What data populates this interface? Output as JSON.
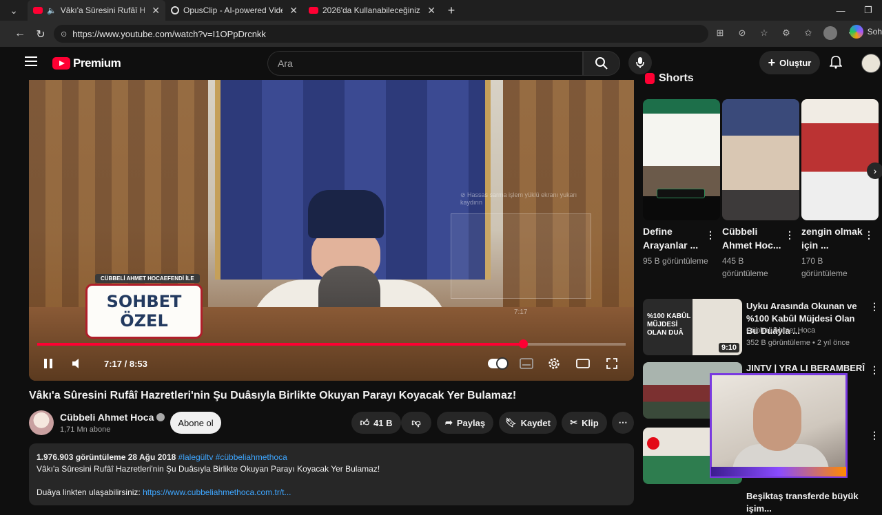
{
  "browser": {
    "tabs": [
      {
        "title": "Vâkı'a Sûresini Rufâî Hazretleri",
        "active": true
      },
      {
        "title": "OpusClip - AI-powered Video Rep",
        "active": false
      },
      {
        "title": "2026'da Kullanabileceğiniz En İyi 0",
        "active": false
      }
    ],
    "url": "https://www.youtube.com/watch?v=I1OPpDrcnkk",
    "copilot_label": "Soh"
  },
  "header": {
    "logo_text": "Premium",
    "search_placeholder": "Ara",
    "create_label": "Oluştur"
  },
  "player": {
    "overlay_top": "CÜBBELİ AHMET HOCAEFENDİ İLE",
    "overlay_line1": "SOHBET",
    "overlay_line2": "ÖZEL",
    "ghost_text": "⊘ Hassas sarma işlem yüklü ekranı yukarı kaydırın",
    "ghost_time": "7:17",
    "time": "7:17 / 8:53",
    "progress": 0.825
  },
  "video": {
    "title": "Vâkı'a Sûresini Rufâî Hazretleri'nin Şu Duâsıyla Birlikte Okuyan Parayı Koyacak Yer Bulamaz!",
    "channel": "Cübbeli Ahmet Hoca",
    "subscribers": "1,71 Mn abone",
    "subscribe_label": "Abone ol",
    "likes": "41 B",
    "share_label": "Paylaş",
    "save_label": "Kaydet",
    "clip_label": "Klip",
    "views_date": "1.976.903 görüntüleme  28 Ağu 2018",
    "hashtags": "#lalegültv #cübbeliahmethoca",
    "description": "Vâkı'a Sûresini Rufâî Hazretleri'nin Şu Duâsıyla Birlikte Okuyan Parayı Koyacak Yer Bulamaz!",
    "link_prefix": "Duâya linkten ulaşabilirsiniz: ",
    "link": "https://www.cubbeliahmethoca.com.tr/t..."
  },
  "sidebar": {
    "shorts_label": "Shorts",
    "shorts": [
      {
        "title": "Define Arayanlar ...",
        "views": "95 B görüntüleme",
        "thumb_color": "#2e8b57"
      },
      {
        "title": "Cübbeli Ahmet Hoc...",
        "views": "445 B görüntüleme",
        "thumb_color": "#c8b8a0"
      },
      {
        "title": "zengin olmak için ...",
        "views": "170 B görüntüleme",
        "thumb_color": "#e5dfd5"
      }
    ],
    "recs": [
      {
        "title": "Uyku Arasında Okunan ve %100 Kabûl Müjdesi Olan Bu Duâyla ...",
        "channel": "Cübbeli Ahmet Hoca",
        "meta": "352 B görüntüleme • 2 yıl önce",
        "duration": "9:10",
        "thumb_text": "%100 KABÛL MÜJDESİ OLAN DUÂ"
      },
      {
        "title": "JINTV | YRA LI BERAMBERÎ",
        "channel": "",
        "meta": "",
        "duration": "",
        "thumb_text": ""
      },
      {
        "title": "",
        "channel": "",
        "meta": "",
        "duration": "",
        "thumb_text": ""
      },
      {
        "title": "Beşiktaş transferde büyük işim...",
        "channel": "",
        "meta": "",
        "duration": "",
        "thumb_text": ""
      }
    ]
  }
}
